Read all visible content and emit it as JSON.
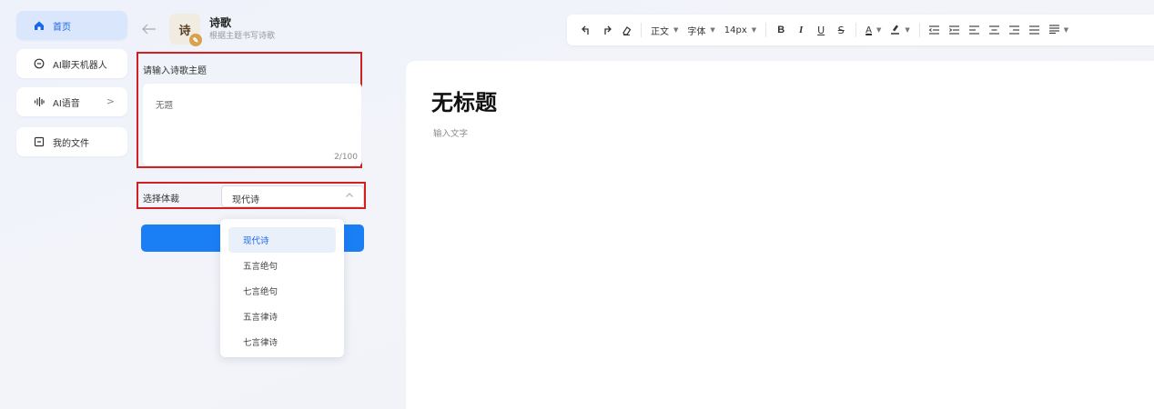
{
  "sidebar": {
    "items": [
      {
        "label": "首页",
        "icon": "home-icon",
        "active": true
      },
      {
        "label": "AI聊天机器人",
        "icon": "chat-icon"
      },
      {
        "label": "AI语音",
        "icon": "voice-wave-icon",
        "has_chevron": true
      },
      {
        "label": "我的文件",
        "icon": "file-icon"
      }
    ],
    "chevron": ">"
  },
  "tool": {
    "icon_text": "诗",
    "title": "诗歌",
    "subtitle": "根据主题书写诗歌"
  },
  "form": {
    "topic_label": "请输入诗歌主题",
    "topic_value": "无题",
    "char_count": "2/100",
    "genre_label": "选择体裁",
    "genre_value": "现代诗"
  },
  "dropdown": {
    "options": [
      "现代诗",
      "五言绝句",
      "七言绝句",
      "五言律诗",
      "七言律诗"
    ],
    "selected": "现代诗"
  },
  "toolbar": {
    "paragraph": "正文",
    "font": "字体",
    "size": "14px",
    "bold": "B",
    "italic": "I",
    "underline": "U",
    "strike": "S",
    "font_color": "A"
  },
  "editor": {
    "title": "无标题",
    "placeholder": "输入文字"
  },
  "colors": {
    "accent": "#1a7ff5",
    "highlight_border": "#d21f1f",
    "active_nav_bg": "#d9e6fb"
  }
}
